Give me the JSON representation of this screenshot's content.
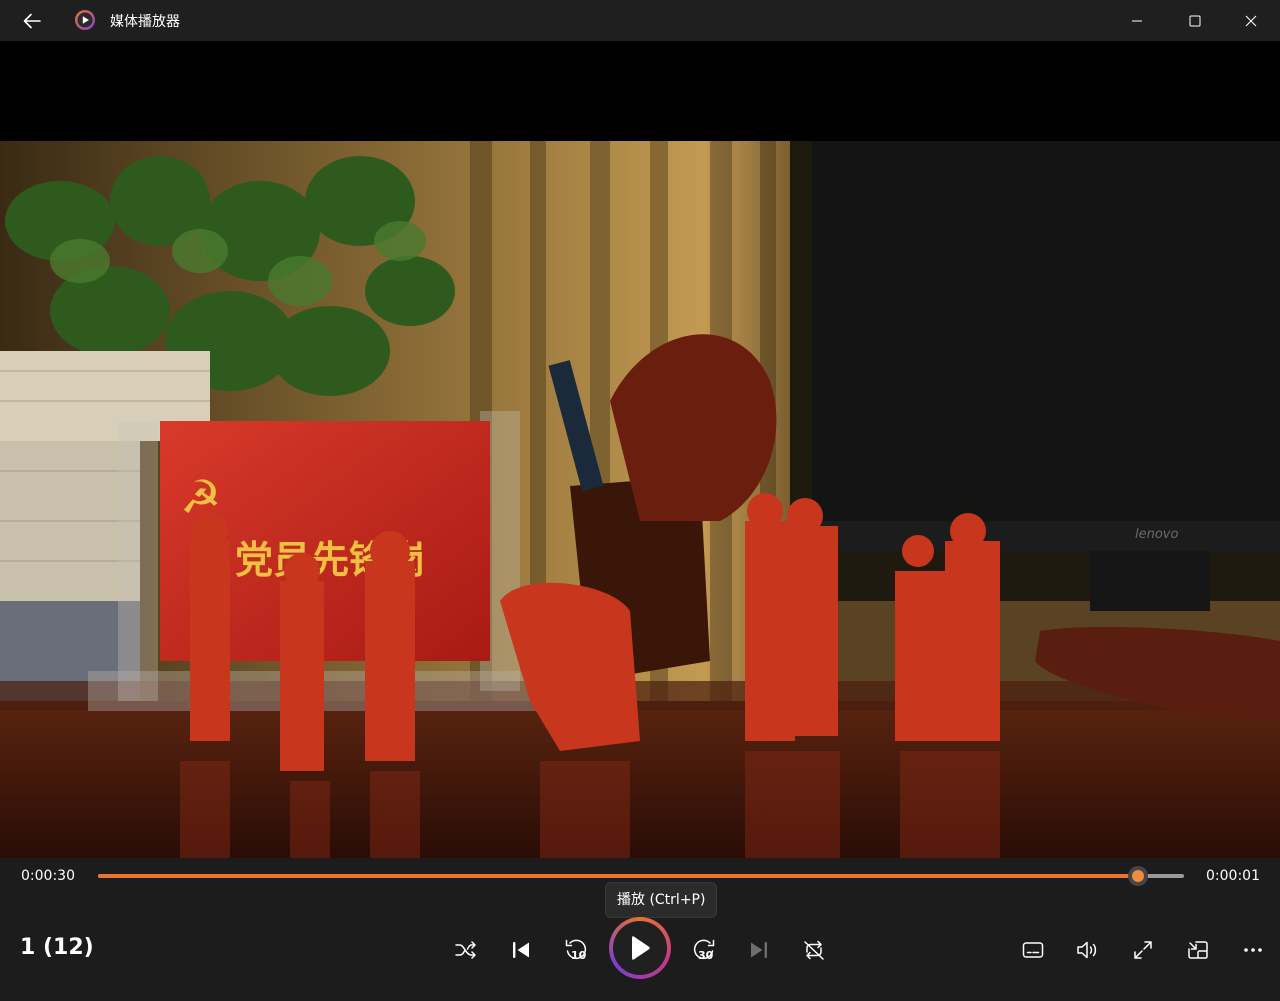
{
  "app": {
    "title": "媒体播放器"
  },
  "video": {
    "sign_text": "党员先锋岗",
    "monitor_brand": "lenovo"
  },
  "playback": {
    "elapsed": "0:00:30",
    "remaining": "0:00:01",
    "progress_fraction": 0.958,
    "tooltip": "播放 (Ctrl+P)",
    "track_label": "1 (12)",
    "skip_back_seconds": "10",
    "skip_forward_seconds": "30"
  },
  "colors": {
    "accent": "#e8742e",
    "background": "#1c1c1c"
  },
  "icons": [
    "back-arrow-icon",
    "app-icon",
    "minimize-icon",
    "maximize-icon",
    "close-icon",
    "shuffle-icon",
    "previous-icon",
    "skip-back-10-icon",
    "play-icon",
    "skip-forward-30-icon",
    "next-icon",
    "repeat-icon",
    "subtitles-icon",
    "volume-icon",
    "fullscreen-icon",
    "mini-player-icon",
    "more-icon"
  ]
}
